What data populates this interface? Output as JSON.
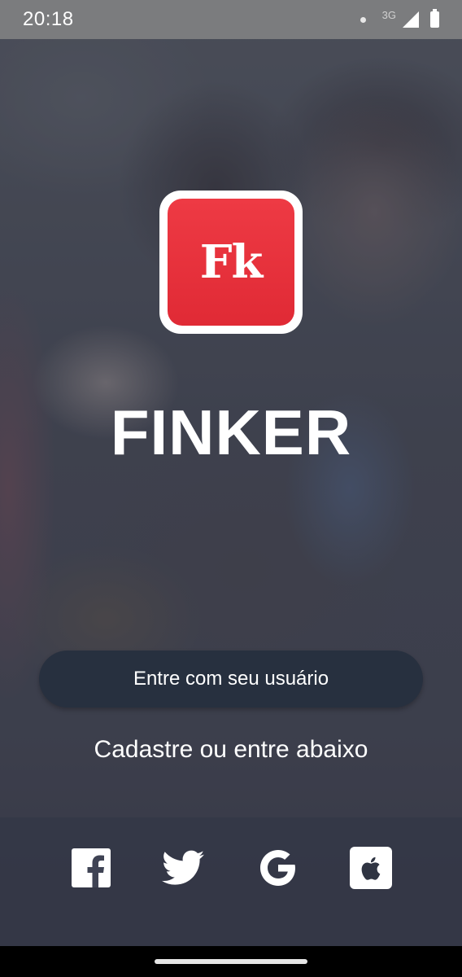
{
  "status_bar": {
    "time": "20:18",
    "network": "3G"
  },
  "logo": {
    "text": "Fk"
  },
  "app": {
    "title": "FINKER"
  },
  "login_button": {
    "label": "Entre com seu usuário"
  },
  "subtitle": "Cadastre ou entre abaixo",
  "social": {
    "items": [
      {
        "icon": "facebook-icon"
      },
      {
        "icon": "twitter-icon"
      },
      {
        "icon": "google-icon"
      },
      {
        "icon": "apple-icon"
      }
    ]
  },
  "colors": {
    "logo_red": "#e8323d",
    "button_bg": "#27303f",
    "text": "#ffffff"
  }
}
